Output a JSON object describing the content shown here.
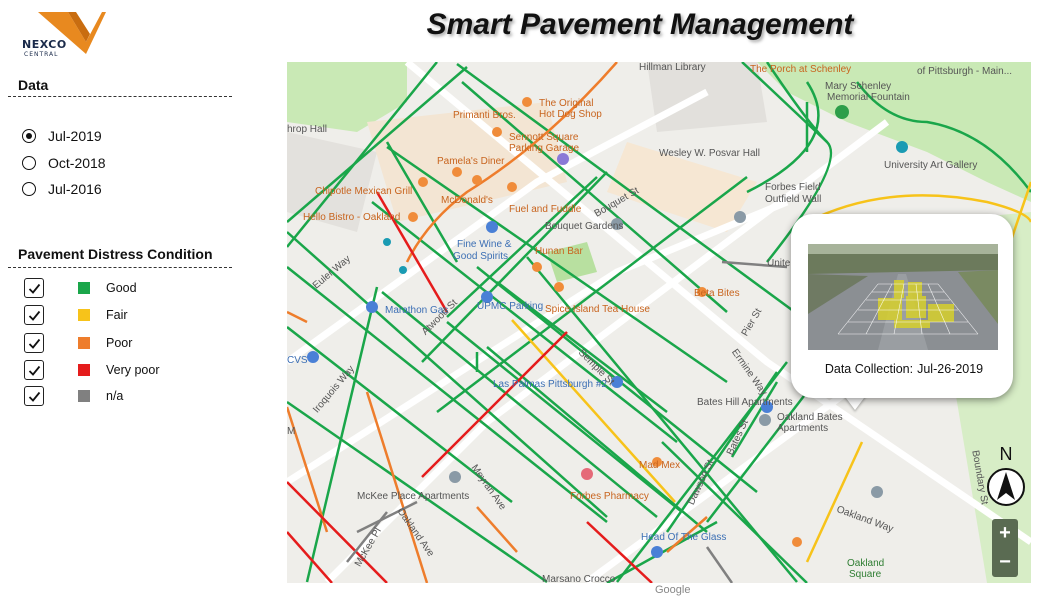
{
  "brand": {
    "name": "NEXCO",
    "sub": "CENTRAL"
  },
  "title": "Smart Pavement Management",
  "data_section": {
    "heading": "Data",
    "options": [
      {
        "label": "Jul-2019",
        "selected": true
      },
      {
        "label": "Oct-2018",
        "selected": false
      },
      {
        "label": "Jul-2016",
        "selected": false
      }
    ]
  },
  "legend": {
    "heading": "Pavement Distress Condition",
    "items": [
      {
        "label": "Good",
        "color": "#1aa64a",
        "checked": true
      },
      {
        "label": "Fair",
        "color": "#f7c31a",
        "checked": true
      },
      {
        "label": "Poor",
        "color": "#ee7d2c",
        "checked": true
      },
      {
        "label": "Very poor",
        "color": "#e51c1c",
        "checked": true
      },
      {
        "label": "n/a",
        "color": "#808080",
        "checked": true
      }
    ]
  },
  "map": {
    "labels": {
      "hillman": "Hillman Library",
      "porch": "The Porch at Schenley",
      "pittsburgh_main": "of Pittsburgh - Main...",
      "mary": "Mary Schenley",
      "memorial": "Memorial Fountain",
      "primanti": "Primanti Bros.",
      "original1": "The Original",
      "original2": "Hot Dog Shop",
      "sennott1": "Sennott Square",
      "sennott2": "Parking Garage",
      "posvar": "Wesley W. Posvar Hall",
      "art_gallery": "University Art Gallery",
      "pamela": "Pamela's Diner",
      "chipotle": "Chipotle Mexican Grill",
      "mcdonalds": "McDonald's",
      "fuel": "Fuel and Fuddle",
      "forbes_field1": "Forbes Field",
      "forbes_field2": "Outfield Wall",
      "bouquet": "Bouquet Gardens",
      "hello": "Hello Bistro - Oakland",
      "finewine1": "Fine Wine &",
      "finewine2": "Good Spirits",
      "hunan": "Hunan Bar",
      "marathon": "Marathon Gas",
      "upmc": "UPMC Parking",
      "spice": "Spice Island Tea House",
      "beta": "Beta Bites",
      "laspalmas": "Las Palmas Pittsburgh #2",
      "bates_hill": "Bates Hill Apartments",
      "oakland_bates1": "Oakland Bates",
      "oakland_bates2": "Apartments",
      "medmex": "Mad Mex",
      "mckee": "McKee Place Apartments",
      "forbes_pharm": "Forbes Pharmacy",
      "headglass": "Head Of The Glass",
      "oakland_sq1": "Oakland",
      "oakland_sq2": "Square",
      "oakland_way": "Oakland Way",
      "cvs": "CVS",
      "hall": "hrop Hall",
      "unite": "Unite",
      "pier": "Pier St",
      "ermine": "Ermine Way",
      "boundary": "Boundary St",
      "euler": "Euler Way",
      "iroquois": "Iroquois Way",
      "bouquet_st": "Bouquet St",
      "atwood": "Atwood St",
      "bates_st": "Bates St",
      "semple": "Semple St",
      "meyran": "Meyran Ave",
      "oakland_ave": "Oakland Ave",
      "dawson": "Dawson St",
      "mcKee_pl": "McKee Pl",
      "mara_crocco": "Marsano Crocco",
      "m_label": "M"
    },
    "google": "Google"
  },
  "popup": {
    "caption_label": "Data Collection:",
    "caption_date": "Jul-26-2019"
  },
  "north_label": "N",
  "zoom": {
    "in": "+",
    "out": "−"
  }
}
